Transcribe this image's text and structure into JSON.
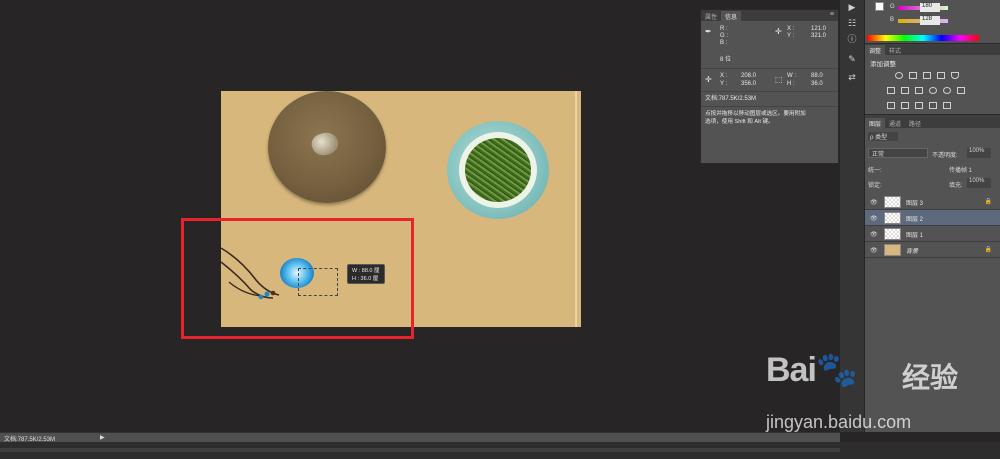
{
  "info_panel": {
    "tabs": [
      "属性",
      "信息"
    ],
    "menu_icon": "panel-menu-icon",
    "r_label": "R :",
    "g_label": "G :",
    "b_label": "B :",
    "bit_label": "8 位",
    "cursor_x": "X :",
    "cursor_x_val": "121.0",
    "cursor_y": "Y :",
    "cursor_y_val": "321.0",
    "pos_x": "X :",
    "pos_x_val": "208.0",
    "pos_y": "Y :",
    "pos_y_val": "356.0",
    "size_w": "W :",
    "size_w_val": "88.0",
    "size_h": "H :",
    "size_h_val": "36.0",
    "doc_info": "文档:787.5K/2.53M",
    "hint_line1": "点按并拖移以移动图层或选区。要用附加",
    "hint_line2": "选项，使用 Shift 和 Alt 键。"
  },
  "tooltip": {
    "w_line": "W : 88.0 厘",
    "h_line": "H : 36.0 厘"
  },
  "color_panel": {
    "g_label": "G",
    "g_value": "180",
    "b_label": "B",
    "b_value": "128"
  },
  "adjust_panel": {
    "tabs": [
      "调整",
      "样式"
    ],
    "title": "添加调整"
  },
  "layers_panel": {
    "tabs": [
      "图层",
      "通道",
      "路径"
    ],
    "filter_label": "ρ 类型",
    "blend_mode": "正常",
    "opacity_label": "不透明度:",
    "opacity_value": "100%",
    "unify_label": "统一:",
    "propagate_label": "传播帧 1",
    "lock_label": "锁定:",
    "fill_label": "填充:",
    "fill_value": "100%",
    "layers": [
      {
        "name": "图层 3",
        "locked": true,
        "selected": false
      },
      {
        "name": "图层 2",
        "locked": false,
        "selected": true
      },
      {
        "name": "图层 1",
        "locked": false,
        "selected": false
      },
      {
        "name": "背景",
        "locked": true,
        "selected": false
      }
    ]
  },
  "status_bar": {
    "doc_info": "文档:787.5K/2.53M"
  },
  "watermark": {
    "logo": "Bai🐾",
    "cn": "经验",
    "url": "jingyan.baidu.com"
  },
  "colors": {
    "canvas_bg": "#d7b77c",
    "highlight_box": "#e7242b",
    "workspace": "#282526"
  }
}
